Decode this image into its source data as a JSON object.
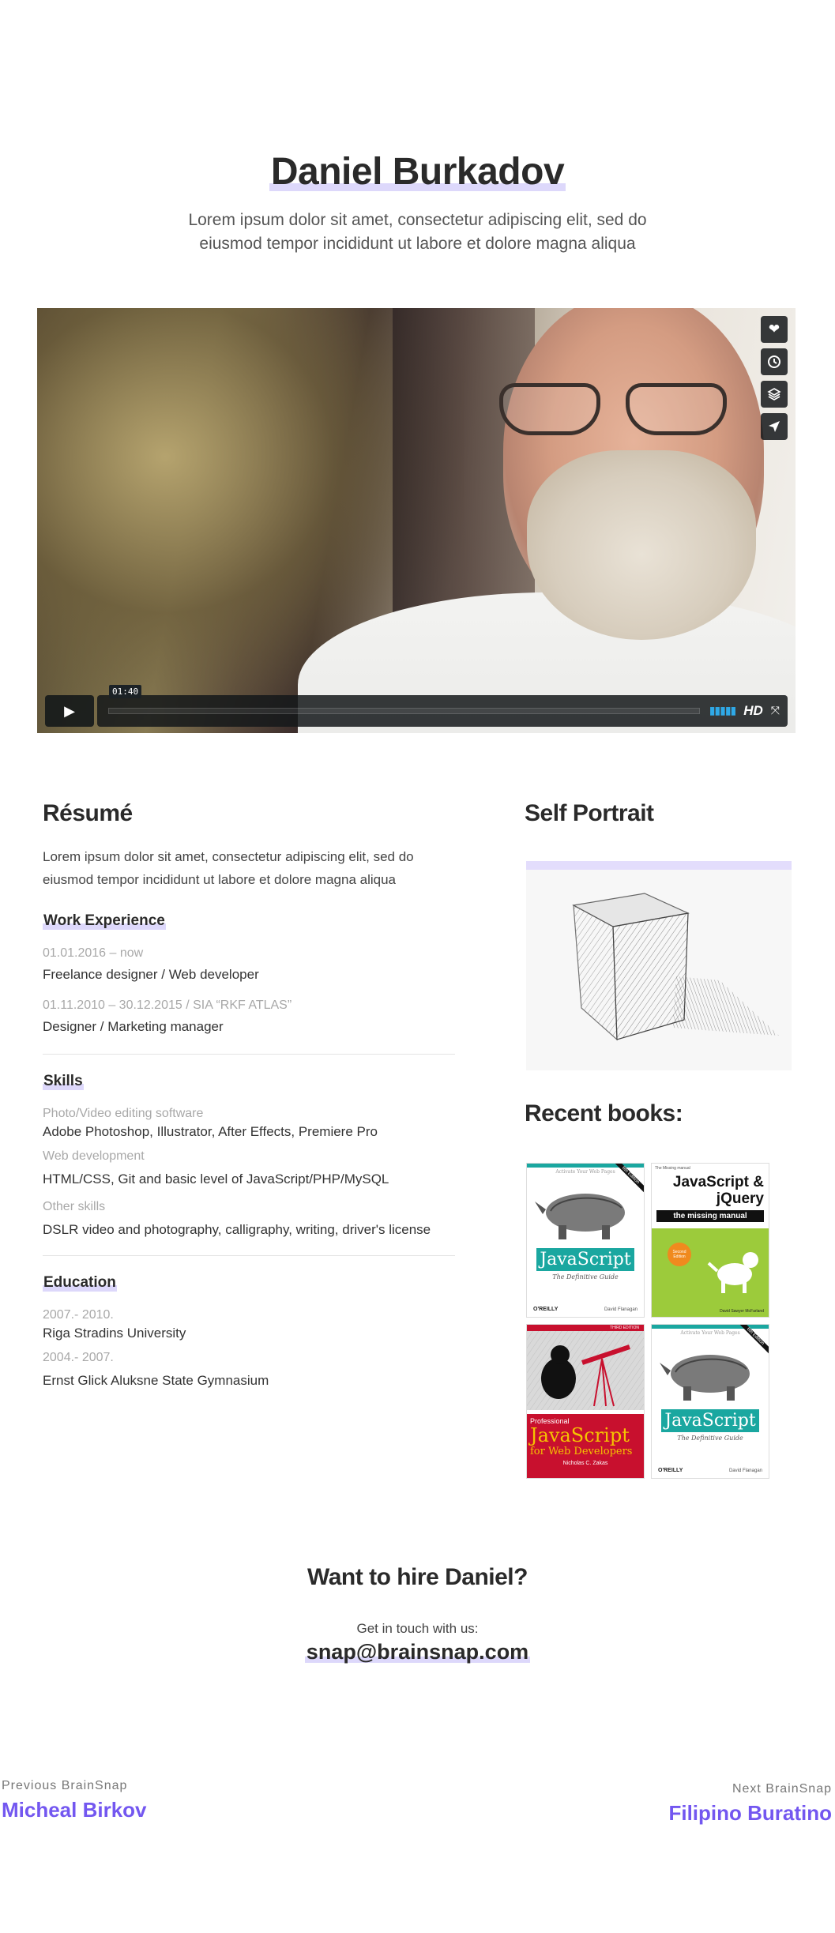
{
  "header": {
    "name": "Daniel Burkadov",
    "intro": "Lorem ipsum dolor sit amet, consectetur adipiscing elit, sed do eiusmod tempor incididunt ut labore et dolore magna aliqua"
  },
  "video": {
    "side_buttons": [
      "heart-icon",
      "clock-icon",
      "layers-icon",
      "send-icon"
    ],
    "time": "01:40",
    "quality": "HD",
    "colors": {
      "volume": "#2fa9e7"
    }
  },
  "resume": {
    "title": "Résumé",
    "intro": "Lorem ipsum dolor sit amet, consectetur adipiscing elit, sed do eiusmod tempor incididunt ut labore et dolore magna aliqua",
    "work": {
      "title": "Work Experience",
      "items": [
        {
          "date": "01.01.2016 – now",
          "role": "Freelance designer / Web developer"
        },
        {
          "date": "01.11.2010 – 30.12.2015 / SIA “RKF ATLAS”",
          "role": "Designer / Marketing manager"
        }
      ]
    },
    "skills": {
      "title": "Skills",
      "items": [
        {
          "label": "Photo/Video editing software",
          "value": "Adobe Photoshop, Illustrator, After Effects, Premiere Pro"
        },
        {
          "label": "Web development",
          "value": "HTML/CSS, Git and basic level of JavaScript/PHP/MySQL"
        },
        {
          "label": "Other skills",
          "value": "DSLR video and photography, calligraphy, writing, driver's license"
        }
      ]
    },
    "education": {
      "title": "Education",
      "items": [
        {
          "years": "2007.- 2010.",
          "school": "Riga Stradins University"
        },
        {
          "years": "2004.- 2007.",
          "school": "Ernst Glick Aluksne State Gymnasium"
        }
      ]
    }
  },
  "sidebar": {
    "portrait_title": "Self Portrait",
    "books_title": "Recent books:",
    "books": [
      {
        "top": "Activate Your Web Pages",
        "title": "JavaScript",
        "subtitle": "The Definitive Guide",
        "publisher": "O'REILLY",
        "author": "David Flanagan",
        "badge": "6th Edition"
      },
      {
        "top": "The Missing manual",
        "title": "JavaScript & jQuery",
        "subtitle": "the missing manual",
        "badge": "Second Edition",
        "author": "David Sawyer McFarland"
      },
      {
        "top": "THIRD EDITION",
        "title": "JavaScript",
        "pre": "Professional",
        "subtitle": "for Web Developers",
        "author": "Nicholas C. Zakas"
      },
      {
        "top": "Activate Your Web Pages",
        "title": "JavaScript",
        "subtitle": "The Definitive Guide",
        "publisher": "O'REILLY",
        "author": "David Flanagan",
        "badge": "6th Edition"
      }
    ]
  },
  "hire": {
    "title": "Want to hire Daniel?",
    "touch": "Get in touch with us:",
    "email": "snap@brainsnap.com"
  },
  "footer": {
    "prev_label": "Previous BrainSnap",
    "prev_name": "Micheal Birkov",
    "next_label": "Next BrainSnap",
    "next_name": "Filipino Buratino",
    "link_color": "#7357f0"
  }
}
